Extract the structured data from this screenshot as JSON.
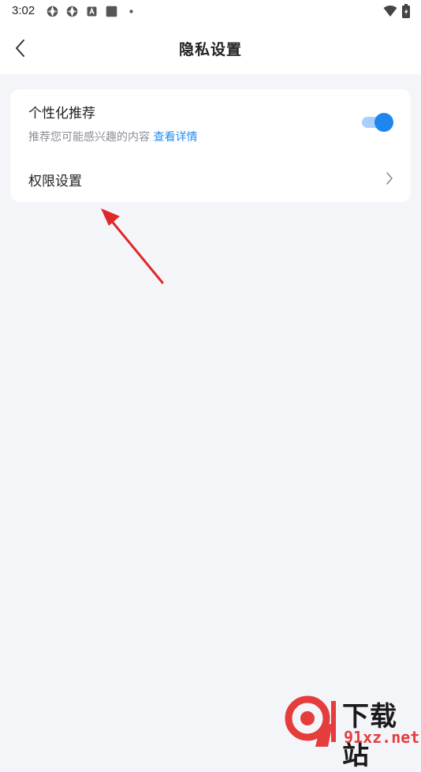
{
  "status_bar": {
    "time": "3:02",
    "left_icons": [
      "app-icon",
      "app-icon",
      "a-icon",
      "square-icon",
      "dot-icon"
    ],
    "right_icons": [
      "wifi-icon",
      "battery-icon"
    ]
  },
  "nav": {
    "title": "隐私设置",
    "back_icon": "chevron-left-icon"
  },
  "settings": {
    "personalized": {
      "title": "个性化推荐",
      "description": "推荐您可能感兴趣的内容",
      "link": "查看详情",
      "enabled": true
    },
    "permission": {
      "title": "权限设置",
      "chevron_icon": "chevron-right-icon"
    }
  },
  "colors": {
    "accent": "#1f86f0",
    "toggle_track": "#a7d0fb",
    "annotation": "#e02828",
    "background": "#f4f5f9"
  },
  "watermark": {
    "name": "下载站",
    "site": "91xz.net"
  }
}
